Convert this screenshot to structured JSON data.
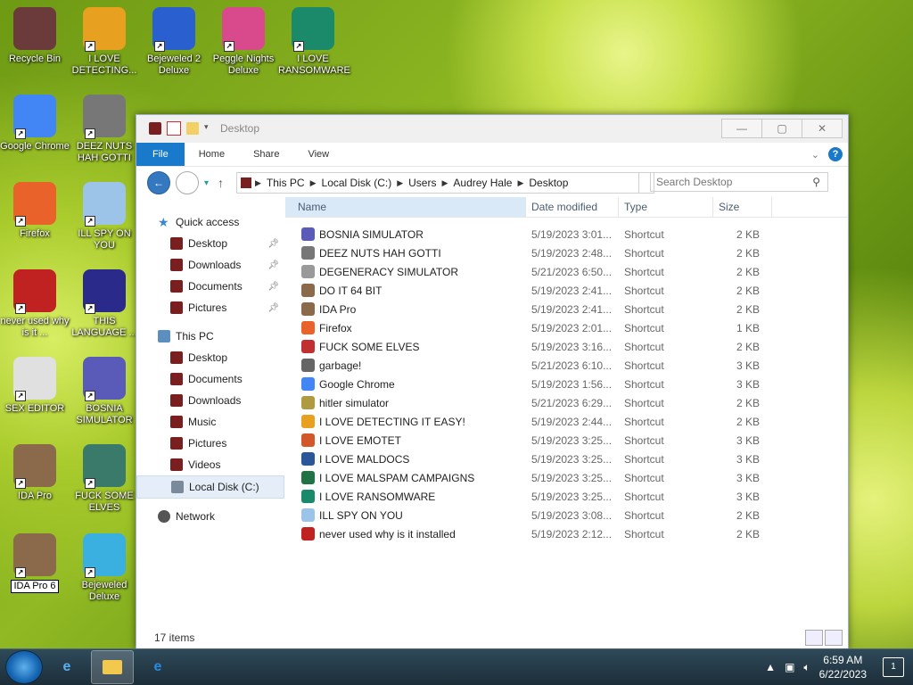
{
  "desktop_icons": [
    {
      "label": "Recycle Bin",
      "icon": "recycle-bin-icon",
      "color": "#6b3a3a"
    },
    {
      "label": "I LOVE DETECTING...",
      "icon": "die-icon",
      "color": "#e8a020"
    },
    {
      "label": "Bejeweled 2 Deluxe",
      "icon": "bejeweled-2-icon",
      "color": "#2a5fd0"
    },
    {
      "label": "Peggle Nights Deluxe",
      "icon": "peggle-icon",
      "color": "#d94a8c"
    },
    {
      "label": "I LOVE RANSOMWARE",
      "icon": "publisher-icon",
      "color": "#1a8a6a"
    },
    {
      "label": "Google Chrome",
      "icon": "chrome-icon",
      "color": "#4285f4"
    },
    {
      "label": "DEEZ NUTS HAH GOTTI",
      "icon": "windows-stack-icon",
      "color": "#777777"
    },
    {
      "label": "Firefox",
      "icon": "firefox-icon",
      "color": "#e8622a"
    },
    {
      "label": "ILL SPY ON YOU",
      "icon": "spy-icon",
      "color": "#9cc4e8"
    },
    {
      "label": "never used why is it ...",
      "icon": "devcpp-icon",
      "color": "#c02222"
    },
    {
      "label": "THIS LANGUAGE ...",
      "icon": "goland-icon",
      "color": "#2a2a8a"
    },
    {
      "label": "SEX EDITOR",
      "icon": "hxd-icon",
      "color": "#e0e0e0"
    },
    {
      "label": "BOSNIA SIMULATOR",
      "icon": "virus-icon",
      "color": "#5a5ab8"
    },
    {
      "label": "IDA Pro",
      "icon": "ida-icon",
      "color": "#8a6a4a"
    },
    {
      "label": "FUCK SOME ELVES",
      "icon": "santa-icon",
      "color": "#3a7a6a"
    },
    {
      "label": "IDA Pro 6",
      "icon": "ida64-icon",
      "color": "#8a6a4a"
    },
    {
      "label": "Bejeweled Deluxe",
      "icon": "diamond-icon",
      "color": "#3ab0e0"
    }
  ],
  "window": {
    "title": "Desktop",
    "tabs": [
      "File",
      "Home",
      "Share",
      "View"
    ],
    "address": [
      "This PC",
      "Local Disk (C:)",
      "Users",
      "Audrey Hale",
      "Desktop"
    ],
    "search_placeholder": "Search Desktop",
    "help": "?"
  },
  "nav": {
    "quick_access": "Quick access",
    "quick_items": [
      "Desktop",
      "Downloads",
      "Documents",
      "Pictures"
    ],
    "this_pc": "This PC",
    "pc_items": [
      "Desktop",
      "Documents",
      "Downloads",
      "Music",
      "Pictures",
      "Videos",
      "Local Disk (C:)"
    ],
    "network": "Network"
  },
  "columns": {
    "name": "Name",
    "date": "Date modified",
    "type": "Type",
    "size": "Size"
  },
  "files": [
    {
      "name": "BOSNIA SIMULATOR",
      "date": "5/19/2023 3:01...",
      "type": "Shortcut",
      "size": "2 KB",
      "color": "#5a5ab8"
    },
    {
      "name": "DEEZ NUTS HAH GOTTI",
      "date": "5/19/2023 2:48...",
      "type": "Shortcut",
      "size": "2 KB",
      "color": "#777777"
    },
    {
      "name": "DEGENERACY SIMULATOR",
      "date": "5/21/2023 6:50...",
      "type": "Shortcut",
      "size": "2 KB",
      "color": "#999999"
    },
    {
      "name": "DO IT 64 BIT",
      "date": "5/19/2023 2:41...",
      "type": "Shortcut",
      "size": "2 KB",
      "color": "#8a6a4a"
    },
    {
      "name": "IDA Pro",
      "date": "5/19/2023 2:41...",
      "type": "Shortcut",
      "size": "2 KB",
      "color": "#8a6a4a"
    },
    {
      "name": "Firefox",
      "date": "5/19/2023 2:01...",
      "type": "Shortcut",
      "size": "1 KB",
      "color": "#e8622a"
    },
    {
      "name": "FUCK SOME ELVES",
      "date": "5/19/2023 3:16...",
      "type": "Shortcut",
      "size": "2 KB",
      "color": "#c03030"
    },
    {
      "name": "garbage!",
      "date": "5/21/2023 6:10...",
      "type": "Shortcut",
      "size": "3 KB",
      "color": "#666666"
    },
    {
      "name": "Google Chrome",
      "date": "5/19/2023 1:56...",
      "type": "Shortcut",
      "size": "3 KB",
      "color": "#4285f4"
    },
    {
      "name": "hitler simulator",
      "date": "5/21/2023 6:29...",
      "type": "Shortcut",
      "size": "2 KB",
      "color": "#b09a40"
    },
    {
      "name": "I LOVE DETECTING IT EASY!",
      "date": "5/19/2023 2:44...",
      "type": "Shortcut",
      "size": "2 KB",
      "color": "#e8a020"
    },
    {
      "name": "I LOVE EMOTET",
      "date": "5/19/2023 3:25...",
      "type": "Shortcut",
      "size": "3 KB",
      "color": "#d2582a"
    },
    {
      "name": "I LOVE MALDOCS",
      "date": "5/19/2023 3:25...",
      "type": "Shortcut",
      "size": "3 KB",
      "color": "#2b579a"
    },
    {
      "name": "I LOVE MALSPAM CAMPAIGNS",
      "date": "5/19/2023 3:25...",
      "type": "Shortcut",
      "size": "3 KB",
      "color": "#217346"
    },
    {
      "name": "I LOVE RANSOMWARE",
      "date": "5/19/2023 3:25...",
      "type": "Shortcut",
      "size": "3 KB",
      "color": "#1a8a6a"
    },
    {
      "name": "ILL SPY ON YOU",
      "date": "5/19/2023 3:08...",
      "type": "Shortcut",
      "size": "2 KB",
      "color": "#9cc4e8"
    },
    {
      "name": "never used why is it installed",
      "date": "5/19/2023 2:12...",
      "type": "Shortcut",
      "size": "2 KB",
      "color": "#c02222"
    }
  ],
  "status": "17 items",
  "taskbar": {
    "time": "6:59 AM",
    "date": "6/22/2023",
    "notifications": "1"
  }
}
